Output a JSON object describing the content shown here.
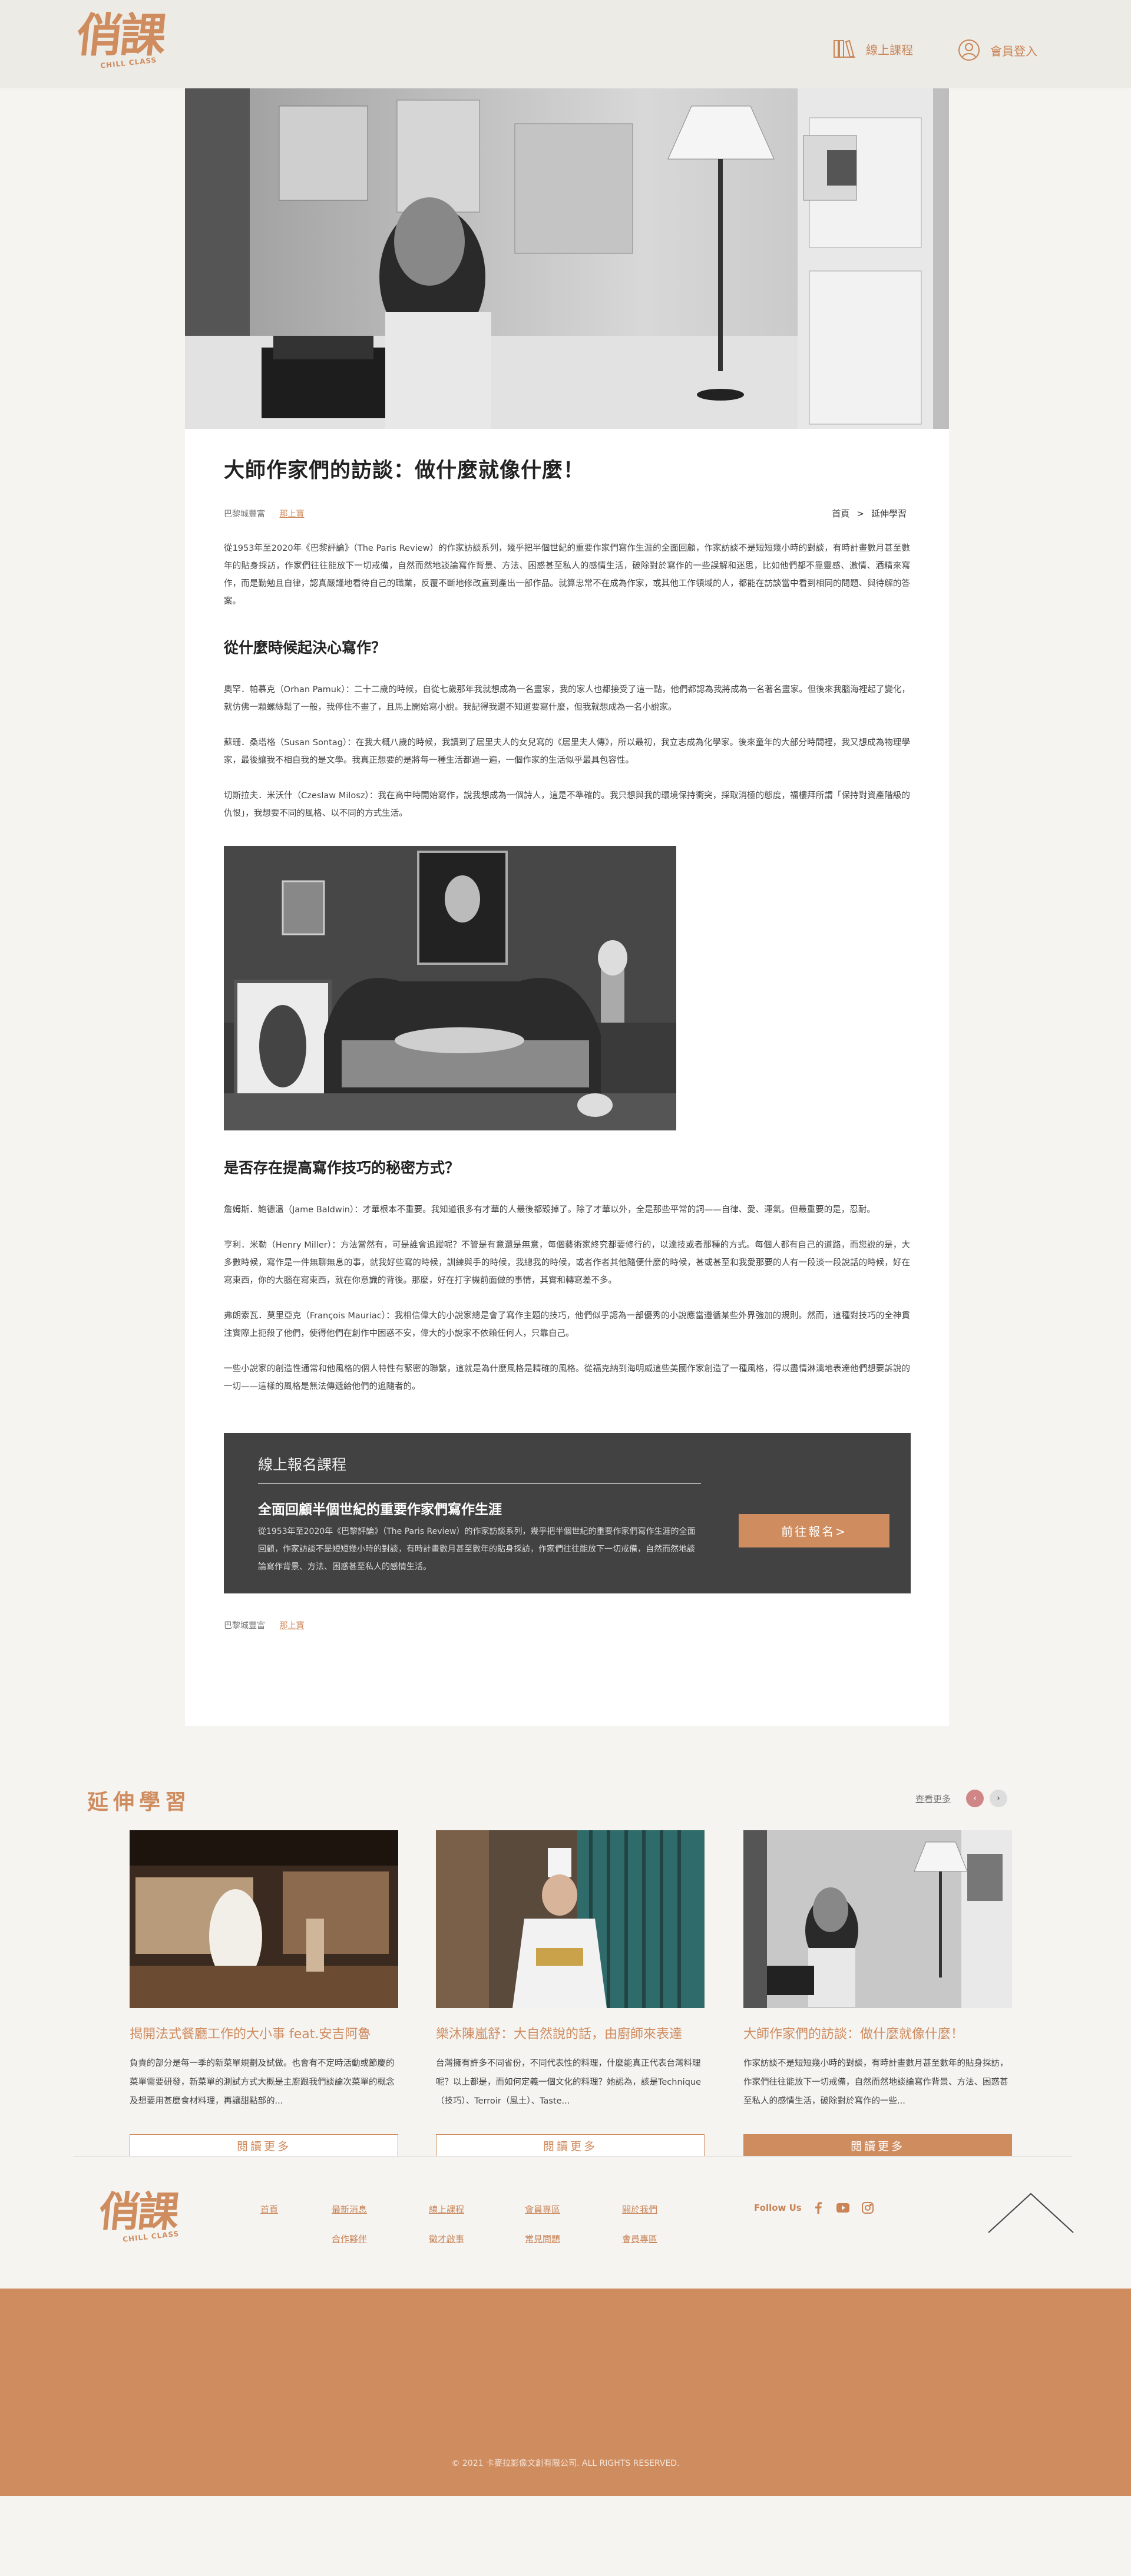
{
  "brand": {
    "logo_text": "俏課",
    "logo_sub": "CHILL CLASS",
    "color": "#cf8c5f"
  },
  "header": {
    "courses_label": "線上課程",
    "login_label": "會員登入"
  },
  "article": {
    "title": "大師作家們的訪談：做什麼就像什麼！",
    "meta": {
      "date": "巴黎城豐富",
      "author": "那上寶"
    },
    "breadcrumb": {
      "home": "首頁",
      "separator": ">",
      "current": "延伸學習"
    },
    "intro": "從1953年至2020年《巴黎評論》（The Paris Review）的作家訪談系列，幾乎把半個世紀的重要作家們寫作生涯的全面回顧，作家訪談不是短短幾小時的對談，有時計畫數月甚至數年的貼身採訪，作家們往往能放下一切戒備，自然而然地談論寫作背景、方法、困惑甚至私人的感情生活，破除對於寫作的一些誤解和迷思，比如他們都不靠靈感、激情、酒精來寫作，而是勤勉且自律，認真嚴謹地看待自己的職業，反覆不斷地修改直到產出一部作品。就算忠常不在成為作家，或其他工作領域的人，都能在訪談當中看到相同的問題、與待解的答案。",
    "section1": {
      "heading": "從什麼時候起決心寫作？",
      "paragraphs": [
        "奧罕．帕慕克（Orhan Pamuk）：二十二歲的時候，自從七歲那年我就想成為一名畫家，我的家人也都接受了這一點，他們都認為我將成為一名著名畫家。但後來我腦海裡起了變化，就仿佛一顆螺絲鬆了一般，我停住不畫了，且馬上開始寫小說。我記得我還不知道要寫什麼，但我就想成為一名小說家。",
        "蘇珊．桑塔格（Susan Sontag）：在我大概八歲的時候，我讀到了居里夫人的女兒寫的《居里夫人傳》，所以最初，我立志成為化學家。後來童年的大部分時間裡，我又想成為物理學家，最後讓我不相自我的是文學。我真正想要的是將每一種生活都過一遍，一個作家的生活似乎最具包容性。",
        "切斯拉夫．米沃什（Czeslaw Milosz）：我在高中時開始寫作，說我想成為一個詩人，這是不準確的。我只想與我的環境保持衝突，採取消極的態度，福樓拜所謂「保持對資產階級的仇恨」，我想要不同的風格、以不同的方式生活。"
      ]
    },
    "section2": {
      "heading": "是否存在提高寫作技巧的秘密方式？",
      "paragraphs": [
        "詹姆斯．鮑德溫（Jame Baldwin）：才華根本不重要。我知道很多有才華的人最後都毀掉了。除了才華以外，全是那些平常的詞——自律、愛、運氣。但最重要的是，忍耐。",
        "亨利．米勒（Henry Miller）：方法當然有，可是誰會追蹤呢？不管是有意還是無意，每個藝術家終究都要修行的，以達技或者那種的方式。每個人都有自己的道路，而您說的是，大多數時候，寫作是一件無聊無息的事，就我好些寫的時候，訓練與手的時候，我總我的時候，或者作者其他隨便什麼的時候，甚或甚至和我愛那要的人有一段淡一段說話的時候，好在寫東西，你的大腦在寫東西，就在你意識的背後。那麼，好在打字機前面做的事情，其實和轉寫差不多。",
        "弗朗索瓦．莫里亞克（François Mauriac）：我相信偉大的小說家總是會了寫作主題的技巧，他們似乎認為一部優秀的小說應當遵循某些外界強加的規則。然而，這種對技巧的全神貫注實際上扼殺了他們，使得他們在創作中困惑不安，偉大的小說家不依賴任何人，只靠自己。",
        "一些小說家的創造性通常和他風格的個人特性有緊密的聯繫，這就是為什麼風格是精確的風格。從福克納到海明威這些美國作家創造了一種風格，得以盡情淋漓地表達他們想要訴說的一切——這樣的風格是無法傳遞給他們的追隨者的。"
      ]
    },
    "promo": {
      "label": "線上報名課程",
      "title": "全面回顧半個世紀的重要作家們寫作生涯",
      "desc": "從1953年至2020年《巴黎評論》（The Paris Review）的作家訪談系列，幾乎把半個世紀的重要作家們寫作生涯的全面回顧，作家訪談不是短短幾小時的對談，有時計畫數月甚至數年的貼身採訪，作家們往往能放下一切戒備，自然而然地談論寫作背景、方法、困惑甚至私人的感情生活。",
      "button": "前往報名>"
    }
  },
  "extension": {
    "title": "延伸學習",
    "more": "查看更多",
    "cards": [
      {
        "title": "揭開法式餐廳工作的大小事 feat.安吉阿魯",
        "desc": "負責的部分是每一季的新菜單規劃及試做。也會有不定時活動或節慶的菜單需要研發，新菜單的測試方式大概是主廚跟我們談論次菜單的概念及想要用甚麼食材料理，再讓甜點部的...",
        "button": "閱讀更多"
      },
      {
        "title": "樂沐陳嵐舒：大自然說的話，由廚師來表達",
        "desc": "台灣擁有許多不同省份，不同代表性的料理，什麼能真正代表台灣料理呢？以上都是，而如何定義一個文化的料理？她認為，該是Technique（技巧）、Terroir（風土）、Taste...",
        "button": "閱讀更多"
      },
      {
        "title": "大師作家們的訪談：做什麼就像什麼！",
        "desc": "作家訪談不是短短幾小時的對談，有時計畫數月甚至數年的貼身採訪，作家們往往能放下一切戒備，自然而然地談論寫作背景、方法、困惑甚至私人的感情生活，破除對於寫作的一些...",
        "button": "閱讀更多"
      }
    ]
  },
  "footer": {
    "links_row1": [
      "首頁",
      "最新消息",
      "線上課程",
      "會員專區",
      "關於我們"
    ],
    "links_row2": [
      "合作夥伴",
      "徵才啟事",
      "常見問題",
      "會員專區"
    ],
    "follow": "Follow Us",
    "copyright": "© 2021 卡麥拉影像文創有限公司. ALL RIGHTS RESERVED."
  }
}
